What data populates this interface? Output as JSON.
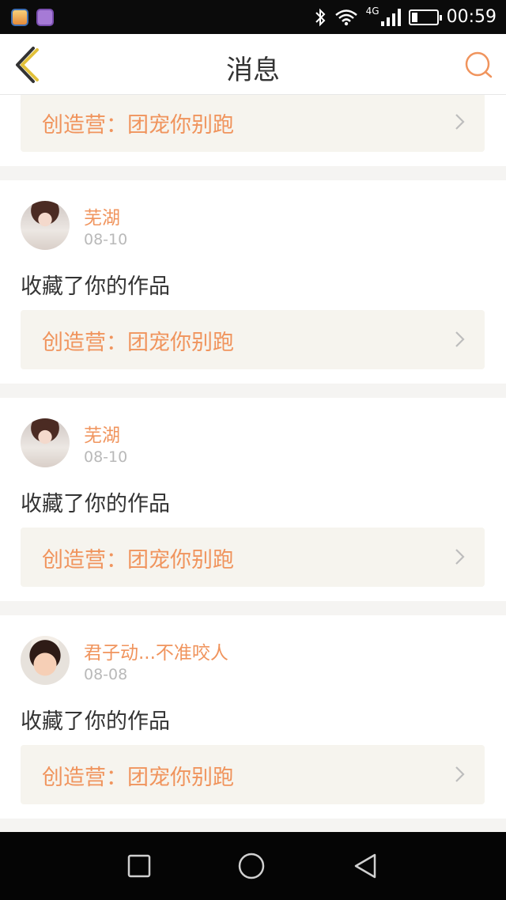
{
  "status_bar": {
    "network": "4G",
    "time": "00:59",
    "battery_level": 0.25
  },
  "nav": {
    "title": "消息",
    "back_icon": "back-chevron-icon",
    "search_icon": "search-icon"
  },
  "colors": {
    "accent": "#f0945d",
    "nav_icon_yellow": "#e2c13a",
    "link_bg": "#f6f4ee"
  },
  "top_partial_card": {
    "work_title": "创造营：团宠你别跑"
  },
  "messages": [
    {
      "user": "芜湖",
      "date": "08-10",
      "action": "收藏了你的作品",
      "work_title": "创造营：团宠你别跑",
      "avatar": "girl-avatar"
    },
    {
      "user": "芜湖",
      "date": "08-10",
      "action": "收藏了你的作品",
      "work_title": "创造营：团宠你别跑",
      "avatar": "girl-avatar"
    },
    {
      "user": "君子动...不准咬人",
      "date": "08-08",
      "action": "收藏了你的作品",
      "work_title": "创造营：团宠你别跑",
      "avatar": "doll-avatar"
    }
  ],
  "system_nav": [
    "recents-square-icon",
    "home-circle-icon",
    "back-triangle-icon"
  ]
}
